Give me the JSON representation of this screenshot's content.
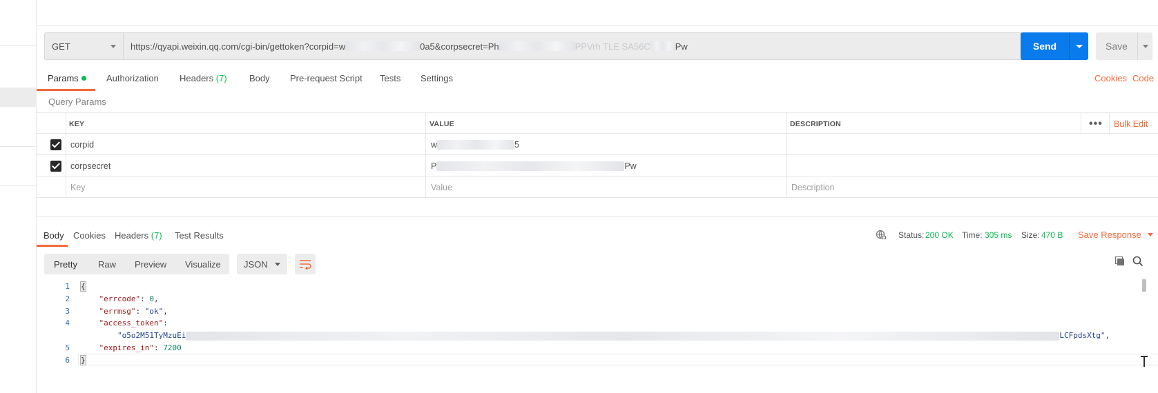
{
  "request": {
    "method": "GET",
    "url_prefix": "https://qyapi.weixin.qq.com/cgi-bin/gettoken?corpid=w",
    "url_mid": "0a5&corpsecret=Ph",
    "url_mid2": "PPVrh TLE  SA56C",
    "url_suffix": "Pw",
    "send_label": "Send",
    "save_label": "Save"
  },
  "request_tabs": {
    "params": "Params",
    "authorization": "Authorization",
    "headers": "Headers",
    "headers_count": "(7)",
    "body": "Body",
    "pre_request": "Pre-request Script",
    "tests": "Tests",
    "settings": "Settings",
    "cookies": "Cookies",
    "code": "Code"
  },
  "query_params": {
    "title": "Query Params",
    "columns": {
      "key": "KEY",
      "value": "VALUE",
      "description": "DESCRIPTION"
    },
    "more": "•••",
    "bulk_edit": "Bulk Edit",
    "rows": [
      {
        "key": "corpid",
        "value_start": "w",
        "value_end": "5"
      },
      {
        "key": "corpsecret",
        "value_start": "P",
        "value_end": "Pw"
      }
    ],
    "placeholder": {
      "key": "Key",
      "value": "Value",
      "description": "Description"
    }
  },
  "response_tabs": {
    "body": "Body",
    "cookies": "Cookies",
    "headers": "Headers",
    "headers_count": "(7)",
    "test_results": "Test Results"
  },
  "response_status": {
    "status_label": "Status:",
    "status_value": "200 OK",
    "time_label": "Time:",
    "time_value": "305 ms",
    "size_label": "Size:",
    "size_value": "470 B",
    "save_response": "Save Response"
  },
  "response_toolbar": {
    "pretty": "Pretty",
    "raw": "Raw",
    "preview": "Preview",
    "visualize": "Visualize",
    "format": "JSON"
  },
  "response_body": {
    "line_numbers": [
      "1",
      "2",
      "3",
      "4",
      "5",
      "6"
    ],
    "open_brace": "{",
    "close_brace": "}",
    "errcode_key": "\"errcode\"",
    "errcode_value": "0",
    "errmsg_key": "\"errmsg\"",
    "errmsg_value": "\"ok\"",
    "access_token_key": "\"access_token\"",
    "access_token_start": "\"o5o2M51TyMzuEi",
    "access_token_end": "LCFpdsXtg\"",
    "expires_in_key": "\"expires_in\"",
    "expires_in_value": "7200"
  },
  "colors": {
    "accent": "#f26b3a",
    "primary_button": "#097bed",
    "success": "#0cbb52"
  }
}
